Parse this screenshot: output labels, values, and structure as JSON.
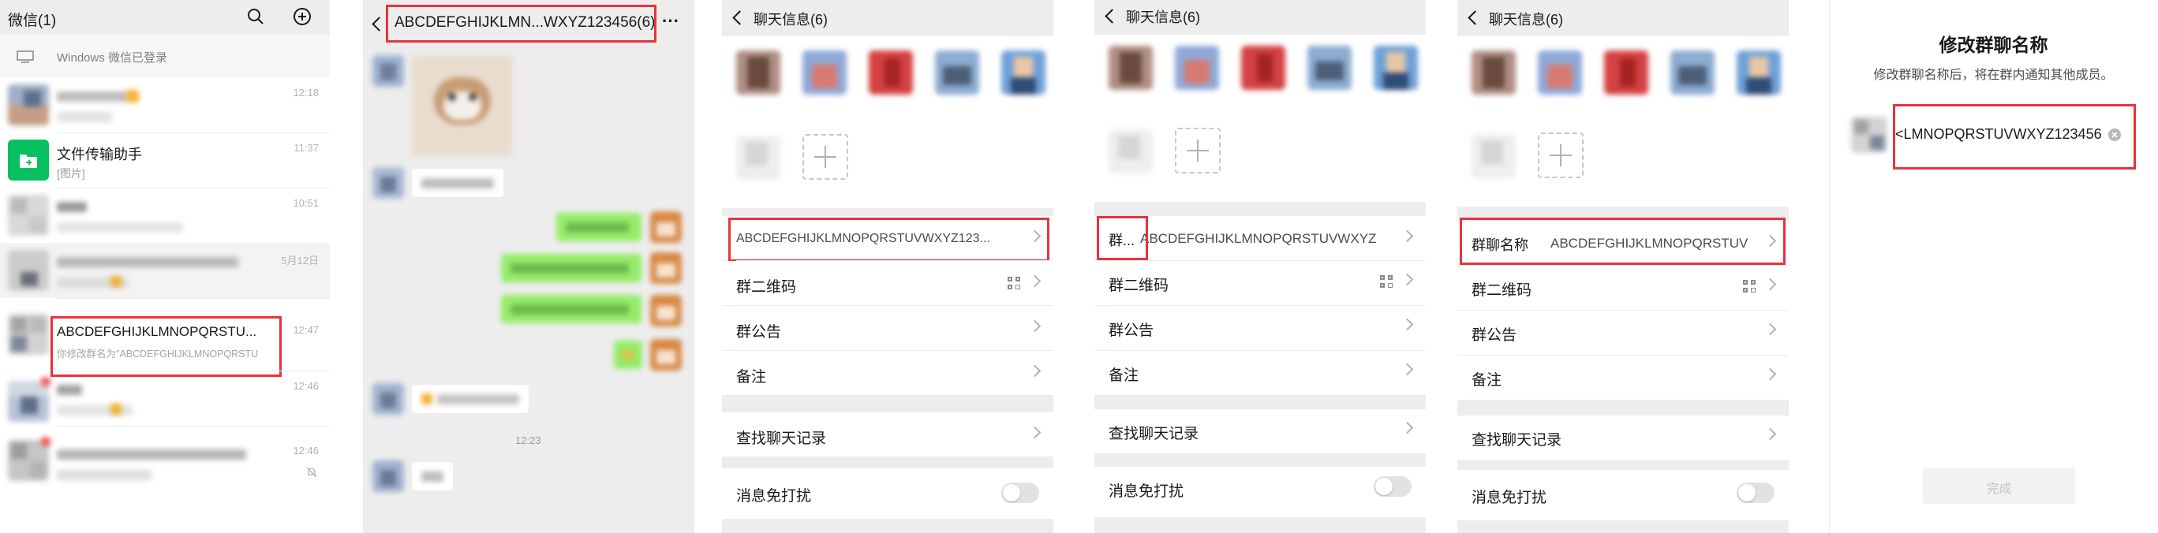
{
  "panel1": {
    "title": "微信(1)",
    "windows_banner": "Windows 微信已登录",
    "chats": [
      {
        "time": "12:18"
      },
      {
        "name": "文件传输助手",
        "preview": "[图片]",
        "time": "11:37"
      },
      {
        "time": "10:51"
      },
      {
        "time": "5月12日"
      },
      {
        "name": "ABCDEFGHIJKLMNOPQRSTU...",
        "preview": "你修改群名为\"ABCDEFGHIJKLMNOPQRSTU",
        "time": "12:47"
      },
      {
        "time": "12:46"
      },
      {
        "time": "12:46"
      }
    ]
  },
  "panel2": {
    "title": "ABCDEFGHIJKLMN...WXYZ123456(6)",
    "more": "···",
    "time_label": "12:23"
  },
  "panel3": {
    "title": "聊天信息(6)",
    "group_name_value": "ABCDEFGHIJKLMNOPQRSTUVWXYZ123...",
    "qr_label": "群二维码",
    "notice_label": "群公告",
    "remark_label": "备注",
    "search_label": "查找聊天记录",
    "mute_label": "消息免打扰"
  },
  "panel4": {
    "title": "聊天信息(6)",
    "group_name_label": "群...",
    "group_name_value": "ABCDEFGHIJKLMNOPQRSTUVWXYZ",
    "qr_label": "群二维码",
    "notice_label": "群公告",
    "remark_label": "备注",
    "search_label": "查找聊天记录",
    "mute_label": "消息免打扰"
  },
  "panel5": {
    "title": "聊天信息(6)",
    "group_name_label": "群聊名称",
    "group_name_value": "ABCDEFGHIJKLMNOPQRSTUV",
    "qr_label": "群二维码",
    "notice_label": "群公告",
    "remark_label": "备注",
    "search_label": "查找聊天记录",
    "mute_label": "消息免打扰"
  },
  "panel6": {
    "title": "修改群聊名称",
    "subtitle": "修改群聊名称后，将在群内通知其他成员。",
    "input_value": "<LMNOPQRSTUVWXYZ123456",
    "done_label": "完成"
  },
  "colors": {
    "highlight": "#e8333d",
    "wechat_green": "#07c160",
    "bubble_green": "#95ec69"
  }
}
